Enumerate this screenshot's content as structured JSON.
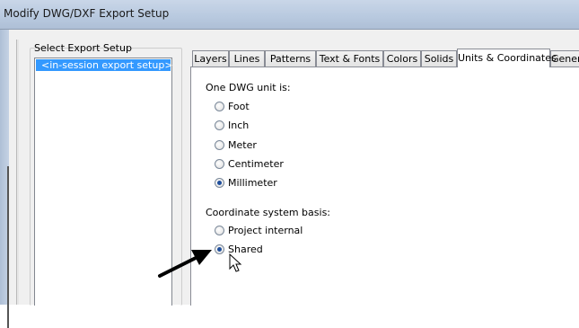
{
  "window": {
    "title": "Modify DWG/DXF Export Setup"
  },
  "export_setup": {
    "label": "Select Export Setup",
    "items": [
      "<in-session export setup>"
    ]
  },
  "tabs": [
    "Layers",
    "Lines",
    "Patterns",
    "Text & Fonts",
    "Colors",
    "Solids",
    "Units & Coordinates",
    "General"
  ],
  "active_tab": "Units & Coordinates",
  "units": {
    "label": "One DWG unit is:",
    "options": [
      "Foot",
      "Inch",
      "Meter",
      "Centimeter",
      "Millimeter"
    ],
    "selected": "Millimeter"
  },
  "coordinates": {
    "label": "Coordinate system basis:",
    "options": [
      "Project internal",
      "Shared"
    ],
    "selected": "Shared"
  },
  "annotations": {
    "arrow_color": "#000000"
  },
  "icons": [
    "mouse-cursor-icon",
    "pointer-arrow-icon"
  ]
}
